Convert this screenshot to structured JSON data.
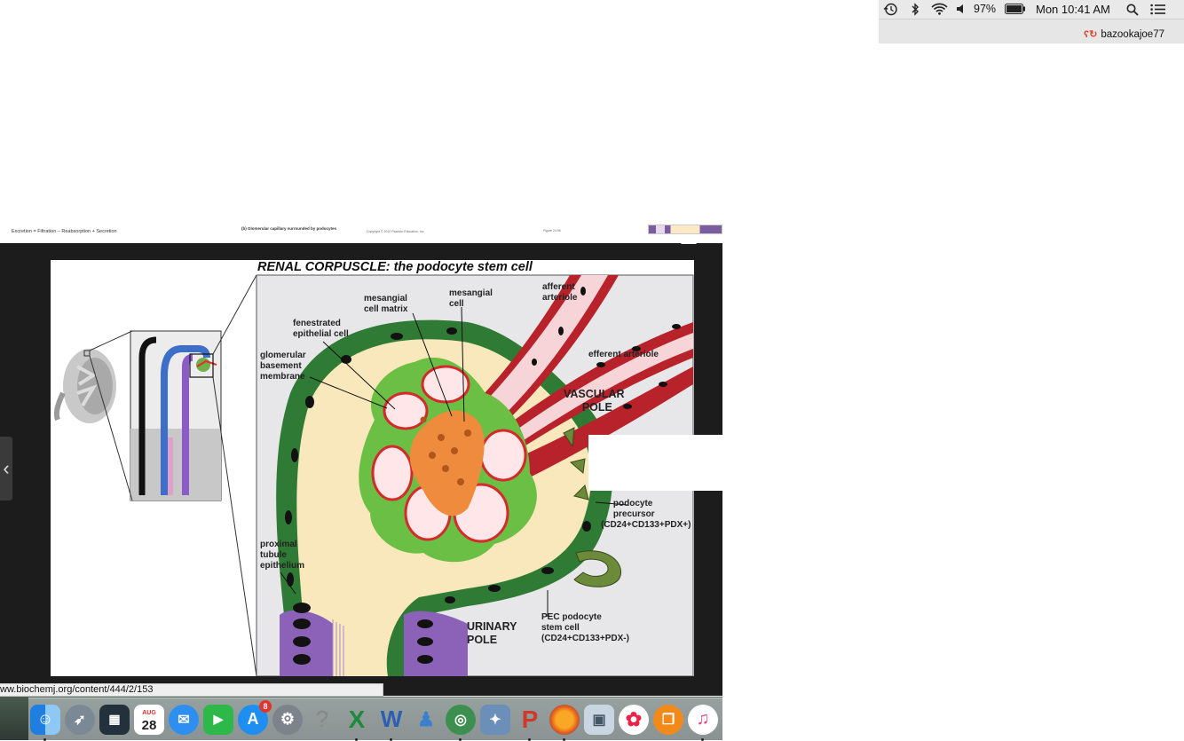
{
  "menubar": {
    "battery": "97%",
    "clock": "Mon 10:41 AM",
    "user": "bazookajoe77"
  },
  "slide_strip": {
    "left_text": "Excretion = Filtration – Reabsorption + Secretion",
    "center_text": "(b) Glomerular capillary surrounded by podocytes",
    "copyright_text": "Copyright © 2012 Pearson Education, Inc.",
    "figure_ref": "Figure 24.9b"
  },
  "figure": {
    "title": "RENAL CORPUSCLE: the podocyte stem cell",
    "labels": {
      "mesangial_matrix": "mesangial\ncell matrix",
      "mesangial_cell": "mesangial\ncell",
      "afferent": "afferent\narteriole",
      "fenestrated": "fenestrated\nepithelial cell",
      "gbm": "glomerular\nbasement\nmembrane",
      "efferent": "efferent arteriole",
      "vascular_pole": "VASCULAR\nPOLE",
      "podocyte_precursor": "podocyte\nprecursor\n(CD24+CD133+PDX+)",
      "proximal": "proximal\ntubule\nepithelium",
      "urinary_pole": "URINARY\nPOLE",
      "pec": "PEC podocyte\nstem cell\n(CD24+CD133+PDX-)"
    }
  },
  "status_url": "ww.biochemj.org/content/444/2/153",
  "dock": {
    "calendar_month": "AUG",
    "calendar_day": "28",
    "appstore_badge": "8",
    "items": [
      {
        "name": "finder-icon",
        "color": "#2f8be6",
        "glyph": "☺"
      },
      {
        "name": "launchpad-icon",
        "color": "#7a8794",
        "glyph": "🚀"
      },
      {
        "name": "mission-control-icon",
        "color": "#2b3b4a",
        "glyph": "▦"
      },
      {
        "name": "calendar-icon",
        "color": "#ffffff",
        "glyph": ""
      },
      {
        "name": "messages-icon",
        "color": "#2d8ff0",
        "glyph": "💬"
      },
      {
        "name": "facetime-icon",
        "color": "#2fb84a",
        "glyph": "▶"
      },
      {
        "name": "app-store-icon",
        "color": "#1f8ef1",
        "glyph": "A"
      },
      {
        "name": "system-preferences-icon",
        "color": "#8a8f96",
        "glyph": "⚙"
      },
      {
        "name": "help-icon",
        "color": "transparent",
        "glyph": "?"
      },
      {
        "name": "excel-icon",
        "color": "#1e7a3c",
        "glyph": "X"
      },
      {
        "name": "word-icon",
        "color": "#2b5fb4",
        "glyph": "W"
      },
      {
        "name": "people-icon",
        "color": "#3c7fd0",
        "glyph": "👥"
      },
      {
        "name": "network-globe-icon",
        "color": "#3c8f4f",
        "glyph": "🌐"
      },
      {
        "name": "preview-icon",
        "color": "#6b8fb8",
        "glyph": "🛰"
      },
      {
        "name": "powerpoint-icon",
        "color": "#d0382a",
        "glyph": "P"
      },
      {
        "name": "firefox-icon",
        "color": "#e8631c",
        "glyph": "🦊"
      },
      {
        "name": "image-viewer-icon",
        "color": "#c9d6e2",
        "glyph": "🖼"
      },
      {
        "name": "photos-icon",
        "color": "#ffffff",
        "glyph": "✿"
      },
      {
        "name": "ibooks-icon",
        "color": "#f28a1b",
        "glyph": "📖"
      },
      {
        "name": "itunes-icon",
        "color": "#e8487a",
        "glyph": "♫"
      }
    ]
  }
}
